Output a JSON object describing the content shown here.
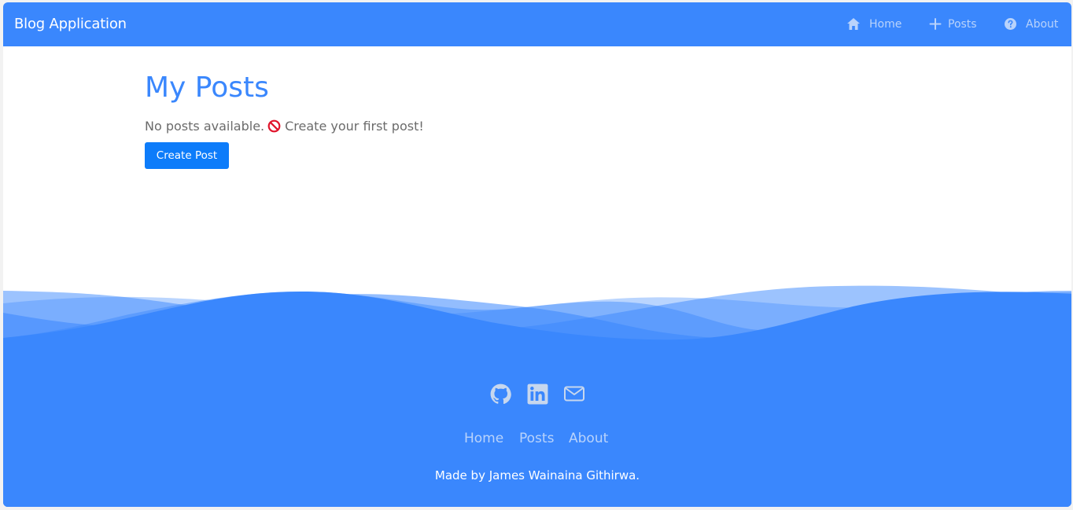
{
  "navbar": {
    "brand": "Blog Application",
    "items": [
      {
        "label": "Home",
        "icon": "home-icon"
      },
      {
        "label": "Posts",
        "icon": "plus-icon"
      },
      {
        "label": "About",
        "icon": "question-circle-icon"
      }
    ]
  },
  "main": {
    "title": "My Posts",
    "empty_text_before": "No posts available.",
    "empty_icon": "prohibited-icon",
    "empty_text_after": "Create your first post!",
    "create_button": "Create Post"
  },
  "footer": {
    "social_icons": [
      "github-icon",
      "linkedin-icon",
      "mail-icon"
    ],
    "links": [
      "Home",
      "Posts",
      "About"
    ],
    "credit": "Made by James Wainaina Githirwa."
  },
  "colors": {
    "primary": "#3a87fd",
    "button": "#0d7cfa",
    "muted_link": "#b9d3fb",
    "prohibited": "#e0142b"
  }
}
